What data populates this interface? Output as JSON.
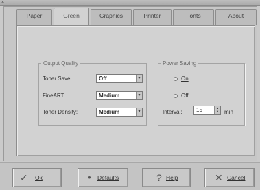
{
  "window": {
    "close_glyph": "×"
  },
  "tabs": [
    {
      "label": "Paper",
      "active": false
    },
    {
      "label": "Green",
      "active": true
    },
    {
      "label": "Graphics",
      "active": false
    },
    {
      "label": "Printer",
      "active": false
    },
    {
      "label": "Fonts",
      "active": false
    },
    {
      "label": "About",
      "active": false
    }
  ],
  "output_quality": {
    "title": "Output Quality",
    "toner_save_label": "Toner Save:",
    "toner_save_value": "Off",
    "fineart_label": "FineART:",
    "fineart_value": "Medium",
    "toner_density_label": "Toner Density:",
    "toner_density_value": "Medium"
  },
  "power_saving": {
    "title": "Power Saving",
    "on_label": "On",
    "off_label": "Off",
    "interval_label": "Interval:",
    "interval_value": "15",
    "interval_unit": "min"
  },
  "buttons": {
    "ok": "Ok",
    "defaults": "Defaults",
    "help": "Help",
    "cancel": "Cancel"
  },
  "icons": {
    "ok": "checkmark-icon",
    "defaults": "dot-icon",
    "help": "question-icon",
    "cancel": "x-icon"
  }
}
